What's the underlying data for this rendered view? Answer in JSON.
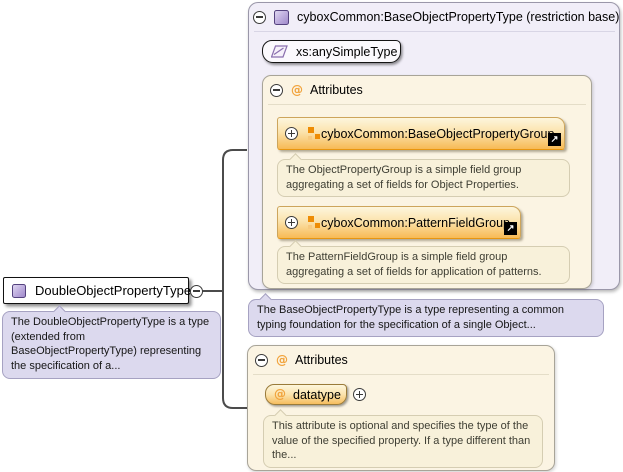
{
  "colors": {
    "panel_lavender": "#f1eef8",
    "section_cream": "#fbf4e3",
    "group_orange": "#f7ba55",
    "note_cream": "#f8f1da",
    "note_purple": "#dcd9ee",
    "accent_orange": "#f1a33c",
    "type_icon_purple": "#a08acb",
    "connector_gray": "#4b4b4b"
  },
  "icons": {
    "link_arrow": "↗"
  },
  "element": {
    "label": "DoubleObjectPropertyType",
    "annotation": "The DoubleObjectPropertyType is a type (extended from BaseObjectPropertyType) representing the specification of a..."
  },
  "base_panel": {
    "title": "cyboxCommon:BaseObjectPropertyType (restriction base)",
    "base_type": "xs:anySimpleType",
    "annotation": "The BaseObjectPropertyType is a type representing a common typing foundation for the specification of a single Object...",
    "attributes": {
      "label": "Attributes",
      "groups": [
        {
          "label": "cyboxCommon:BaseObjectPropertyGroup",
          "annotation": "The ObjectPropertyGroup is a simple field group aggregating a set of fields for Object Properties."
        },
        {
          "label": "cyboxCommon:PatternFieldGroup",
          "annotation": "The PatternFieldGroup is a simple field group aggregating a set of fields for application of patterns."
        }
      ]
    }
  },
  "local_attributes": {
    "label": "Attributes",
    "items": [
      {
        "name": "datatype",
        "annotation": "This attribute is optional and specifies the type of the value of the specified property. If a type different than the..."
      }
    ]
  }
}
